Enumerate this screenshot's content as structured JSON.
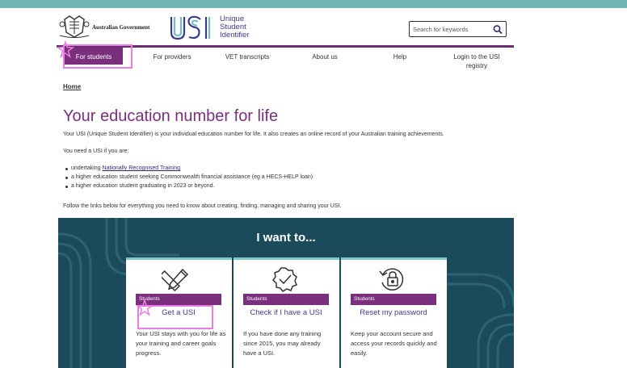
{
  "header": {
    "gov_name": "Australian Government",
    "usi_lines": [
      "Unique",
      "Student",
      "Identifier"
    ],
    "usi_wordmark": "USI",
    "search_placeholder": "Search for keywords",
    "search_icon": "search-icon"
  },
  "nav": {
    "items": [
      {
        "label": "For students",
        "active": true
      },
      {
        "label": "For providers"
      },
      {
        "label": "VET transcripts"
      },
      {
        "label": "About us"
      },
      {
        "label": "Help"
      },
      {
        "label_lines": [
          "Login to the USI",
          "registry"
        ]
      }
    ]
  },
  "breadcrumb": "Home",
  "main": {
    "title": "Your education number for life",
    "intro": "Your USI (Unique Student Identifier) is your individual education number for life. It also creates an online record of your Australian training achievements.",
    "need_intro": "You need a USI if you are:",
    "bullets": [
      {
        "prefix": "undertaking ",
        "link": "Nationally Recognised Training",
        "suffix": ""
      },
      {
        "prefix": "a higher education student seeking Commonwealth financial assistance (eg a HECS-HELP loan)",
        "link": "",
        "suffix": ""
      },
      {
        "prefix": "a higher education student graduating in 2023 or beyond.",
        "link": "",
        "suffix": ""
      }
    ],
    "follow": "Follow the links below for everything you need to know about creating, finding, managing and sharing your USI."
  },
  "band": {
    "title": "I want to...",
    "cards": [
      {
        "category": "Students",
        "link": "Get a USI",
        "desc": "Your USI stays with you for life as your training and career goals progress.",
        "icon": "pencil-ruler-icon"
      },
      {
        "category": "Students",
        "link": "Check if I have a USI",
        "desc": "If you have done any training since 2015, you may already have a USI.",
        "icon": "verified-badge-icon"
      },
      {
        "category": "Students",
        "link": "Reset my password",
        "desc": "Keep your account secure and access your records quickly and easily.",
        "icon": "lock-reset-icon"
      }
    ]
  },
  "colors": {
    "brand_purple": "#7a2f7d",
    "band_teal": "#1b4a5a",
    "top_bar": "#6fb6b0",
    "highlight_pink": "#e87ee3"
  }
}
